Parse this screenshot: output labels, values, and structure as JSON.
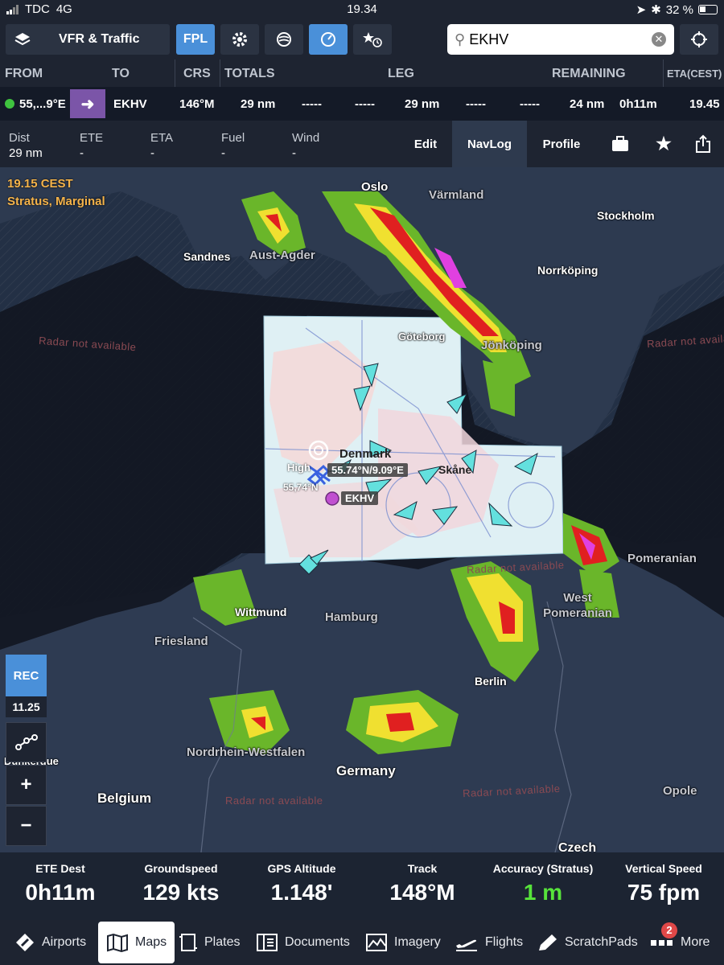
{
  "status_bar": {
    "carrier": "TDC",
    "network": "4G",
    "time": "19.34",
    "battery": "32 %"
  },
  "toolbar": {
    "layers_label": "VFR & Traffic",
    "fpl_label": "FPL",
    "search": {
      "value": "EKHV",
      "placeholder": ""
    }
  },
  "route": {
    "headers": {
      "from": "FROM",
      "to": "TO",
      "crs": "CRS",
      "totals": "TOTALS",
      "leg": "LEG",
      "remaining": "REMAINING",
      "eta": "ETA(CEST)"
    },
    "from": "55,...9°E",
    "to": "EKHV",
    "crs": "146°M",
    "total_dist": "29 nm",
    "dash1": "-----",
    "dash2": "-----",
    "leg_dist": "29 nm",
    "dash3": "-----",
    "dash4": "-----",
    "remaining_dist": "24 nm",
    "remaining_time": "0h11m",
    "eta": "19.45"
  },
  "nav": {
    "stats": [
      {
        "label": "Dist",
        "value": "29 nm"
      },
      {
        "label": "ETE",
        "value": "-"
      },
      {
        "label": "ETA",
        "value": "-"
      },
      {
        "label": "Fuel",
        "value": "-"
      },
      {
        "label": "Wind",
        "value": "-"
      }
    ],
    "edit_label": "Edit",
    "navlog_label": "NavLog",
    "profile_label": "Profile"
  },
  "map": {
    "timestamp": "19.15 CEST",
    "weather_source": "Stratus, Marginal",
    "ownship_coords": "55.74°N/9.09°E",
    "ownship_lat_tag": "55,74°N",
    "ownship_name_tag": "High",
    "destination_tag": "EKHV",
    "labels": {
      "oslo": "Oslo",
      "varmland": "Värmland",
      "stockholm": "Stockholm",
      "sandnes": "Sandnes",
      "aust_agder": "Aust-Agder",
      "norrkoping": "Norrköping",
      "goteborg": "Göteborg",
      "jonkoping": "Jönköping",
      "denmark": "Denmark",
      "skaane": "Skåne",
      "pomeranian": "Pomeranian",
      "west_pomeranian": "West Pomeranian",
      "wittmund": "Wittmund",
      "hamburg": "Hamburg",
      "friesland": "Friesland",
      "berlin": "Berlin",
      "dunkerque": "Dunkerque",
      "nrw": "Nordrhein-Westfalen",
      "germany": "Germany",
      "belgium": "Belgium",
      "opole": "Opole",
      "czech": "Czech",
      "radar_na": "Radar not available"
    },
    "rec_label": "REC",
    "rec_time": "11.25",
    "zoom_in": "+",
    "zoom_out": "−"
  },
  "instruments": [
    {
      "label": "ETE Dest",
      "value": "0h11m",
      "color": "#ffffff"
    },
    {
      "label": "Groundspeed",
      "value": "129 kts",
      "color": "#ffffff"
    },
    {
      "label": "GPS Altitude",
      "value": "1.148'",
      "color": "#ffffff"
    },
    {
      "label": "Track",
      "value": "148°M",
      "color": "#ffffff"
    },
    {
      "label": "Accuracy (Stratus)",
      "value": "1 m",
      "color": "#57e33b"
    },
    {
      "label": "Vertical Speed",
      "value": "75 fpm",
      "color": "#ffffff"
    }
  ],
  "tabs": [
    {
      "label": "Airports",
      "icon": "compass-icon"
    },
    {
      "label": "Maps",
      "icon": "map-icon",
      "active": true
    },
    {
      "label": "Plates",
      "icon": "plate-icon"
    },
    {
      "label": "Documents",
      "icon": "documents-icon"
    },
    {
      "label": "Imagery",
      "icon": "imagery-icon"
    },
    {
      "label": "Flights",
      "icon": "plane-icon"
    },
    {
      "label": "ScratchPads",
      "icon": "pen-icon"
    },
    {
      "label": "More",
      "icon": "more-icon",
      "badge": "2"
    }
  ],
  "colors": {
    "accent": "#4a90d9",
    "bg": "#1e2431",
    "eta_amber": "#f4b34a",
    "radar_na": "#8a4a52"
  }
}
